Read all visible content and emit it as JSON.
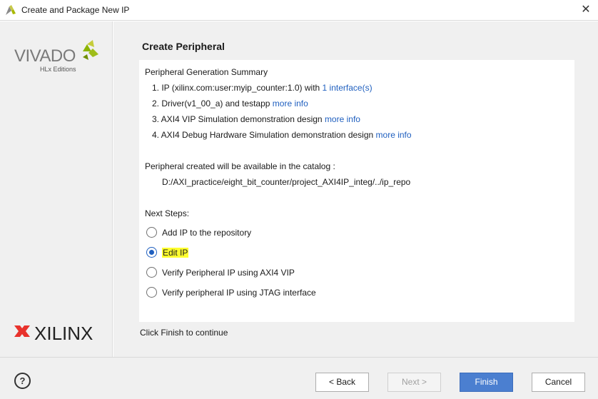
{
  "window": {
    "title": "Create and Package New IP",
    "close_glyph": "✕"
  },
  "sidebar": {
    "vivado_logo": {
      "text": "VIVADO",
      "subtext": "HLx Editions"
    },
    "xilinx_logo": {
      "text": "XILINX"
    }
  },
  "page": {
    "title": "Create Peripheral",
    "summary_heading": "Peripheral Generation Summary",
    "items": [
      {
        "text": "1. IP (xilinx.com:user:myip_counter:1.0) with",
        "link": "1 interface(s)"
      },
      {
        "text": "2. Driver(v1_00_a) and testapp",
        "link": "more info"
      },
      {
        "text": "3. AXI4 VIP Simulation demonstration design",
        "link": "more info"
      },
      {
        "text": "4. AXI4 Debug Hardware Simulation demonstration design",
        "link": "more info"
      }
    ],
    "catalog_text": "Peripheral created will be available in the catalog :",
    "catalog_path": "D:/AXI_practice/eight_bit_counter/project_AXI4IP_integ/../ip_repo",
    "next_steps_heading": "Next Steps:",
    "options": [
      {
        "label": "Add IP to the repository",
        "selected": false
      },
      {
        "label": "Edit IP",
        "selected": true
      },
      {
        "label": "Verify Peripheral IP using AXI4 VIP",
        "selected": false
      },
      {
        "label": "Verify peripheral IP using JTAG interface",
        "selected": false
      }
    ],
    "footer_hint": "Click Finish to continue"
  },
  "buttons": {
    "help": "?",
    "back": "< Back",
    "next": "Next >",
    "finish": "Finish",
    "cancel": "Cancel"
  },
  "colors": {
    "link": "#1f5fbf",
    "primary_button": "#4b7fd0",
    "highlight": "#ffff2e",
    "xilinx_red": "#e8322c",
    "vivado_green": "#8cb400"
  },
  "icons": [
    "vivado-app-icon",
    "close-icon",
    "help-icon"
  ]
}
